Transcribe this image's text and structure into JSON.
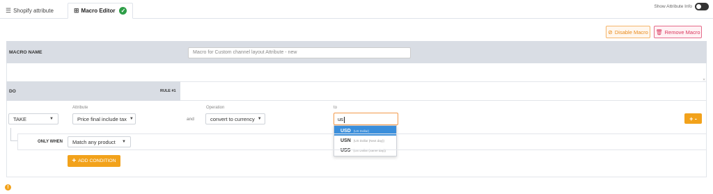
{
  "tabs": [
    {
      "label": "Shopify attribute",
      "icon": "list-icon"
    },
    {
      "label": "Macro Editor",
      "icon": "grid-icon",
      "status_icon": "check-circle-icon"
    }
  ],
  "header": {
    "show_info_label": "Show Attribute Info",
    "toggle_on": false
  },
  "actions": {
    "disable_label": "Disable Macro",
    "remove_label": "Remove Macro"
  },
  "macro": {
    "name_label": "MACRO NAME",
    "name_value": "Macro for Custom channel layout Attribute - new"
  },
  "rule": {
    "do_label": "DO",
    "rule_label": "RULE #1"
  },
  "action_row": {
    "take_value": "TAKE",
    "attribute_label": "Attribute",
    "attribute_value": "Price final include tax",
    "and_text": "and",
    "operation_label": "Operation",
    "operation_value": "convert to currency",
    "to_label": "to",
    "to_value": "us",
    "plus_label": "+ -"
  },
  "currency_options": [
    {
      "code": "USD",
      "desc": "(US Dollar)",
      "selected": true
    },
    {
      "code": "USN",
      "desc": "(US Dollar (Next day))",
      "selected": false
    },
    {
      "code": "USS",
      "desc": "(US Dollar (Same day))",
      "selected": false
    }
  ],
  "condition": {
    "only_when_label": "ONLY WHEN",
    "match_value": "Match any product",
    "add_label": "ADD CONDITION"
  },
  "colors": {
    "accent": "#f2a21b",
    "selected": "#3a8edb",
    "band": "#d9dde4",
    "danger": "#d9365c"
  }
}
